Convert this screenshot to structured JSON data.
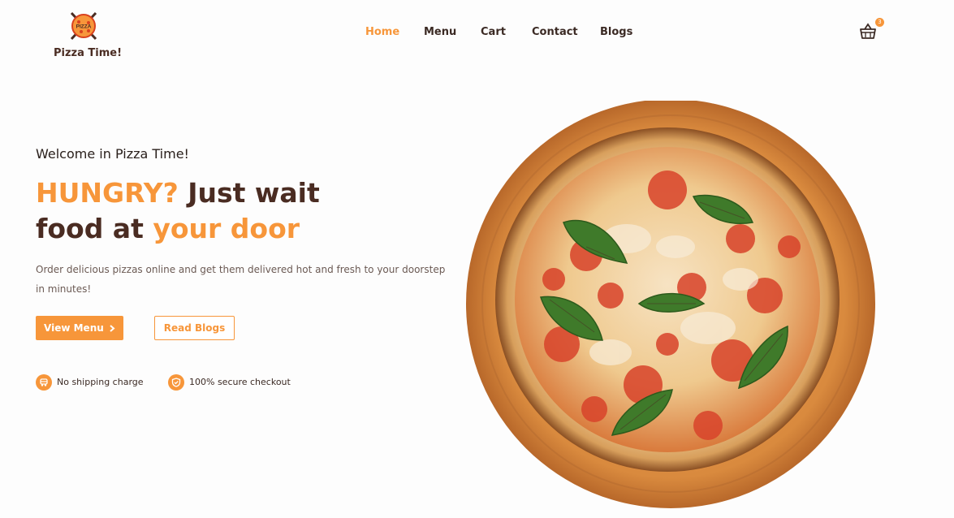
{
  "brand": {
    "logo_badge": "PIZZA",
    "name": "Pizza Time!"
  },
  "nav": [
    {
      "label": "Home",
      "active": true
    },
    {
      "label": "Menu",
      "active": false
    },
    {
      "label": "Cart",
      "active": false
    },
    {
      "label": "Contact",
      "active": false
    },
    {
      "label": "Blogs",
      "active": false
    }
  ],
  "cart": {
    "count": "3",
    "icon": "basket-icon"
  },
  "hero": {
    "welcome": "Welcome in Pizza Time!",
    "headline_accent_1": "HUNGRY?",
    "headline_part_1": " Just wait",
    "headline_part_2": "food at ",
    "headline_accent_2": "your door",
    "description": "Order delicious pizzas online and get them delivered hot and fresh to your doorstep in minutes!",
    "primary_button": "View Menu",
    "primary_button_icon": "chevron-right-icon",
    "secondary_button": "Read Blogs",
    "features": [
      {
        "label": "No shipping charge",
        "icon": "delivery-icon"
      },
      {
        "label": "100% secure checkout",
        "icon": "shield-check-icon"
      }
    ]
  },
  "colors": {
    "accent": "#f7963a",
    "text_dark": "#3b2a24",
    "headline_dark": "#4a2c22",
    "body_text": "#6b5a54",
    "background": "#fdfdfd"
  }
}
